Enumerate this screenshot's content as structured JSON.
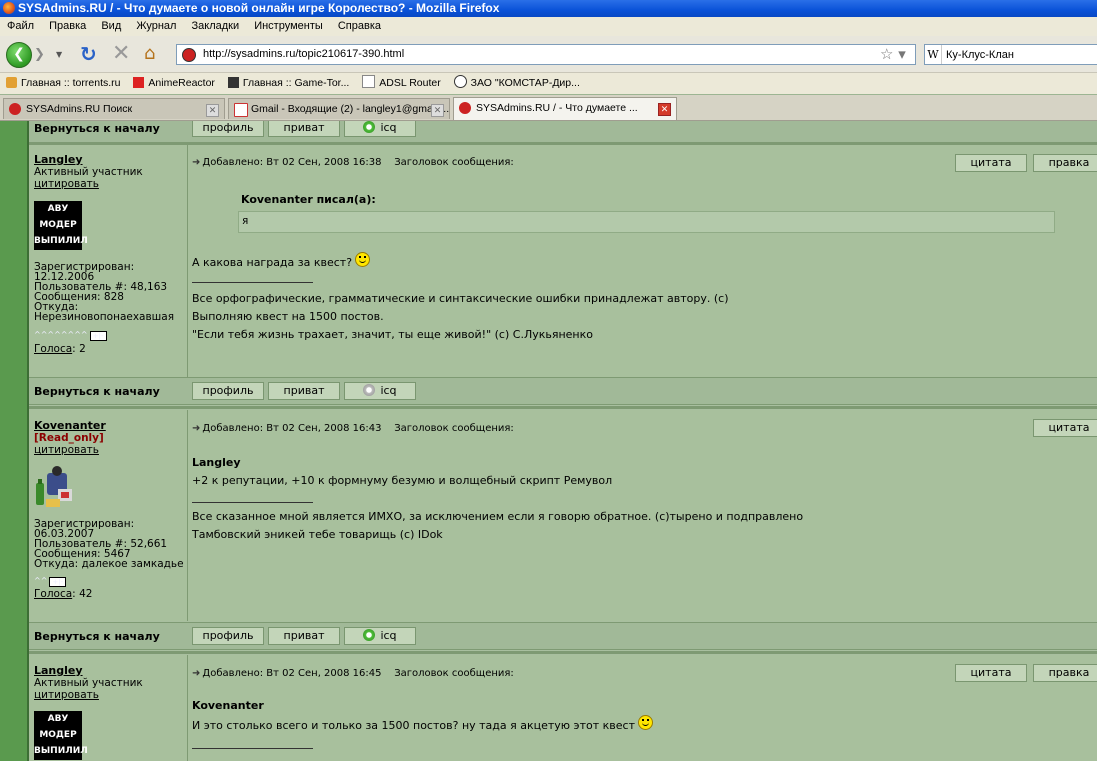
{
  "window": {
    "title": "SYSAdmins.RU / - Что думаете о новой онлайн игре Королество? - Mozilla Firefox"
  },
  "menu": [
    "Файл",
    "Правка",
    "Вид",
    "Журнал",
    "Закладки",
    "Инструменты",
    "Справка"
  ],
  "nav": {
    "url": "http://sysadmins.ru/topic210617-390.html",
    "search_value": "Ку-Клус-Клан",
    "search_engine_icon": "W"
  },
  "bookmarks": [
    "Главная :: torrents.ru",
    "AnimeReactor",
    "Главная :: Game-Tor...",
    "ADSL Router",
    "ЗАО \"КОМСТАР-Дир..."
  ],
  "tabs": [
    {
      "label": "SYSAdmins.RU Поиск",
      "active": false
    },
    {
      "label": "Gmail - Входящие (2) - langley1@gmail....",
      "active": false
    },
    {
      "label": "SYSAdmins.RU / - Что думаете ...",
      "active": true
    }
  ],
  "common": {
    "back_to_top": "Вернуться к началу",
    "profile": "профиль",
    "privat": "приват",
    "icq": "icq",
    "quote": "цитата",
    "edit": "правка",
    "cite_link": "цитировать",
    "votes_label": "Голоса",
    "subject_label": "Заголовок сообщения:"
  },
  "posts": [
    {
      "author": "Langley",
      "rank": "Активный участник",
      "avatar_lines": [
        "АВУ",
        "МОДЕР",
        "ВЫПИЛИЛ"
      ],
      "registered_label": "Зарегистрирован:",
      "registered": "12.12.2006",
      "user_no": "Пользователь #: 48,163",
      "messages": "Сообщения: 828",
      "from_label": "Откуда:",
      "from": "Нерезиновопонаехавшая",
      "votes": "2",
      "date": "Добавлено: Вт 02 Сен, 2008 16:38",
      "quote_author": "Kovenanter писал(а):",
      "quote_text": "я",
      "body": "А какова награда за квест?",
      "signature": [
        "Все орфографические, грамматические и синтаксические ошибки принадлежат автору. (с)",
        "Выполняю квест на 1500 постов.",
        "\"Если тебя жизнь трахает, значит, ты еще живой!\" (с) С.Лукьяненко"
      ]
    },
    {
      "author": "Kovenanter",
      "rank": "[Read_only]",
      "registered_label": "Зарегистрирован:",
      "registered": "06.03.2007",
      "user_no": "Пользователь #: 52,661",
      "messages": "Сообщения: 5467",
      "from": "Откуда: далекое замкадье",
      "votes": "42",
      "date": "Добавлено: Вт 02 Сен, 2008 16:43",
      "reply_to": "Langley",
      "body": "+2 к репутации, +10 к формнуму безумю и волщебный скрипт Ремувол",
      "signature": [
        "Все сказанное мной является ИМХО, за исключением если я говорю обратное. (с)тырено и подправлено",
        "Тамбовский эникей тебе товарищь (с) IDok"
      ]
    },
    {
      "author": "Langley",
      "rank": "Активный участник",
      "avatar_lines": [
        "АВУ",
        "МОДЕР",
        "ВЫПИЛИЛ"
      ],
      "date": "Добавлено: Вт 02 Сен, 2008 16:45",
      "reply_to": "Kovenanter",
      "body": "И это столько всего и только за 1500 постов? ну тада я акцетую этот квест"
    }
  ]
}
